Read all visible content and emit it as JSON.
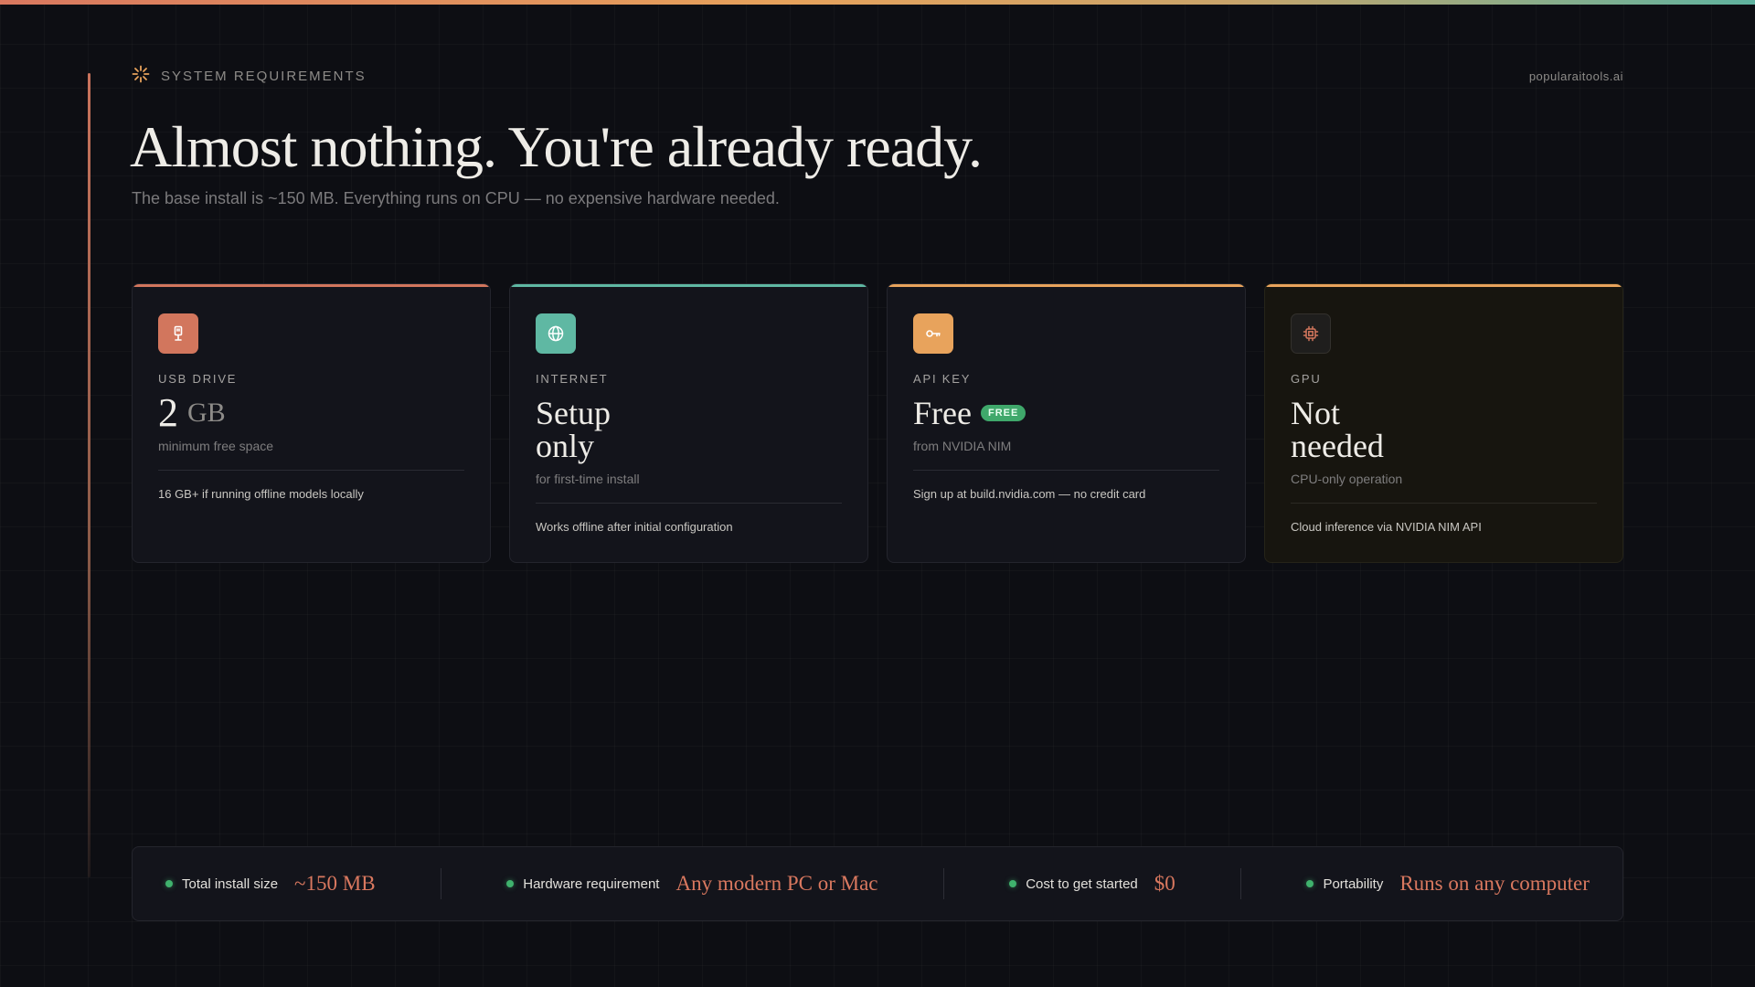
{
  "header": {
    "eyebrow": "SYSTEM REQUIREMENTS",
    "site": "popularaitools.ai"
  },
  "hero": {
    "title": "Almost nothing. You're already ready.",
    "subtitle": "The base install is ~150 MB. Everything runs on CPU — no expensive hardware needed."
  },
  "cards": [
    {
      "label": "USB DRIVE",
      "value": "2",
      "unit": "GB",
      "caption": "minimum free space",
      "note": "16 GB+ if running offline models locally",
      "icon": "usb-drive-icon",
      "accent": "#d2765d"
    },
    {
      "label": "INTERNET",
      "value_line1": "Setup",
      "value_line2": "only",
      "caption": "for first-time install",
      "note": "Works offline after initial configuration",
      "icon": "globe-icon",
      "accent": "#5fb8a3"
    },
    {
      "label": "API KEY",
      "value": "Free",
      "badge": "FREE",
      "caption": "from NVIDIA NIM",
      "note": "Sign up at build.nvidia.com — no credit card",
      "icon": "key-icon",
      "accent": "#e8a35c"
    },
    {
      "label": "GPU",
      "value_line1": "Not",
      "value_line2": "needed",
      "caption": "CPU-only operation",
      "note": "Cloud inference via NVIDIA NIM API",
      "icon": "chip-icon",
      "accent": "#e8a35c"
    }
  ],
  "stats": [
    {
      "label": "Total install size",
      "value": "~150 MB"
    },
    {
      "label": "Hardware requirement",
      "value": "Any modern PC or Mac"
    },
    {
      "label": "Cost to get started",
      "value": "$0"
    },
    {
      "label": "Portability",
      "value": "Runs on any computer"
    }
  ],
  "colors": {
    "background": "#0d0e13",
    "accent_coral": "#d9785f",
    "accent_teal": "#5fb8a3",
    "accent_amber": "#e8a35c",
    "status_green": "#3fb26d"
  }
}
